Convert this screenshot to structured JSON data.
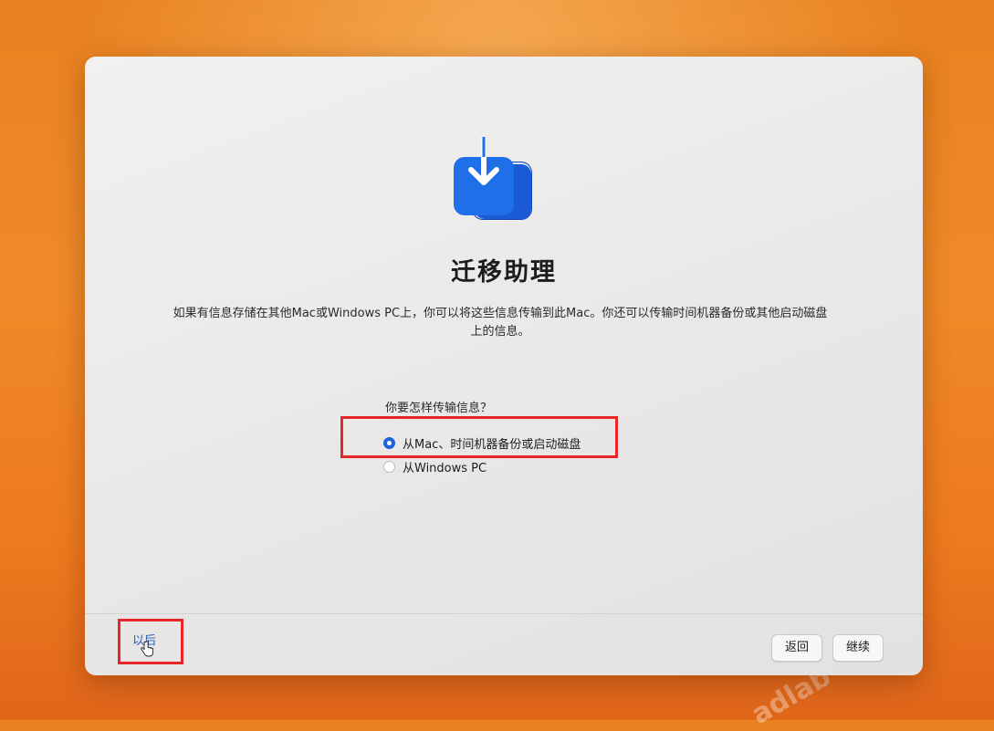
{
  "window": {
    "title": "迁移助理",
    "description": "如果有信息存储在其他Mac或Windows PC上，你可以将这些信息传输到此Mac。你还可以传输时间机器备份或其他启动磁盘上的信息。",
    "question": "你要怎样传输信息？"
  },
  "options": [
    {
      "label": "从Mac、时间机器备份或启动磁盘",
      "selected": true
    },
    {
      "label": "从Windows PC",
      "selected": false
    }
  ],
  "footer": {
    "later_label": "以后",
    "back_label": "返回",
    "continue_label": "继续"
  },
  "watermarks": [
    "adlab",
    "adlab",
    "adlab"
  ],
  "colors": {
    "accent": "#1f63e0",
    "highlight": "#e8262a",
    "background": "#ee7a1e"
  },
  "icons": {
    "app": "migration-assistant-icon",
    "cursor": "hand-pointer-icon"
  }
}
